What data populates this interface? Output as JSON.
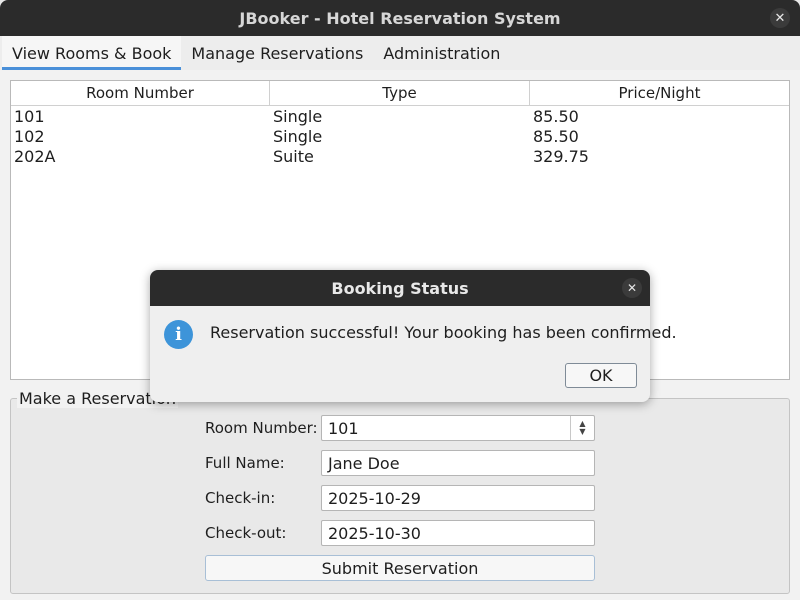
{
  "window": {
    "title": "JBooker - Hotel Reservation System",
    "close_glyph": "✕"
  },
  "tabs": [
    {
      "label": "View Rooms & Book",
      "active": true
    },
    {
      "label": "Manage Reservations",
      "active": false
    },
    {
      "label": "Administration",
      "active": false
    }
  ],
  "rooms_table": {
    "columns": [
      "Room Number",
      "Type",
      "Price/Night"
    ],
    "rows": [
      [
        "101",
        "Single",
        "85.50"
      ],
      [
        "102",
        "Single",
        "85.50"
      ],
      [
        "202A",
        "Suite",
        "329.75"
      ]
    ]
  },
  "reservation_form": {
    "legend": "Make a Reservation",
    "room_label": "Room Number:",
    "room_value": "101",
    "name_label": "Full Name:",
    "name_value": "Jane Doe",
    "checkin_label": "Check-in:",
    "checkin_value": "2025-10-29",
    "checkout_label": "Check-out:",
    "checkout_value": "2025-10-30",
    "submit_label": "Submit Reservation"
  },
  "dialog": {
    "title": "Booking Status",
    "close_glyph": "✕",
    "icon": "info-icon",
    "icon_glyph": "i",
    "message": "Reservation successful! Your booking has been confirmed.",
    "ok_label": "OK"
  },
  "colors": {
    "titlebar": "#2b2b2b",
    "accent": "#4a90d9",
    "info": "#3d94d9"
  }
}
